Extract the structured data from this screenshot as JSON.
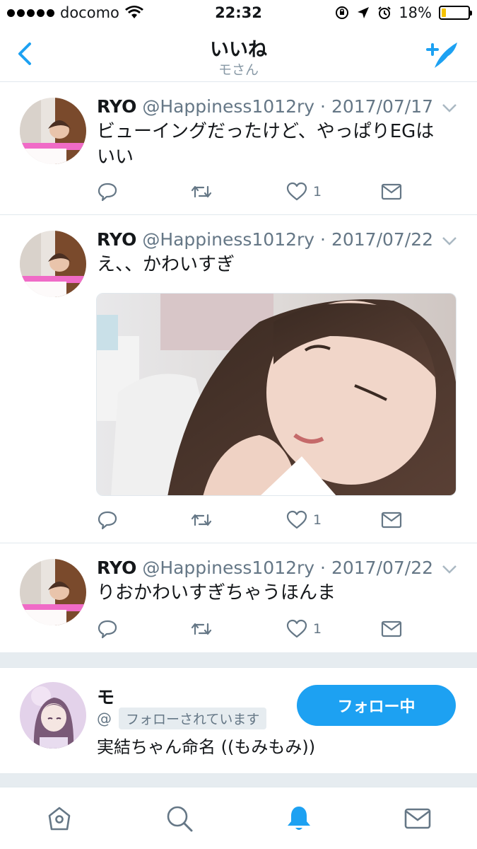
{
  "status_bar": {
    "carrier": "docomo",
    "time": "22:32",
    "battery_percent": "18%",
    "battery_level": 0.18
  },
  "nav": {
    "title": "いいね",
    "subtitle": "モさん"
  },
  "tweets": [
    {
      "name": "RYO",
      "handle": "@Happiness1012ry",
      "date": "2017/07/17",
      "text_line1": "ビューイングだったけど、やっぱりEGは",
      "text_line2": "いい",
      "likes": "1"
    },
    {
      "name": "RYO",
      "handle": "@Happiness1012ry",
      "date": "2017/07/22",
      "text_line1": "え、、かわいすぎ",
      "likes": "1"
    },
    {
      "name": "RYO",
      "handle": "@Happiness1012ry",
      "date": "2017/07/22",
      "text_line1": "りおかわいすぎちゃうほんま",
      "likes": "1"
    }
  ],
  "user_card": {
    "name": "モ",
    "handle": "@",
    "follows_you_badge": "フォローされています",
    "bio": "実結ちゃん命名 ((もみもみ))",
    "follow_button": "フォロー中"
  },
  "icons": {
    "accent": "#1da1f2",
    "muted": "#657786"
  }
}
